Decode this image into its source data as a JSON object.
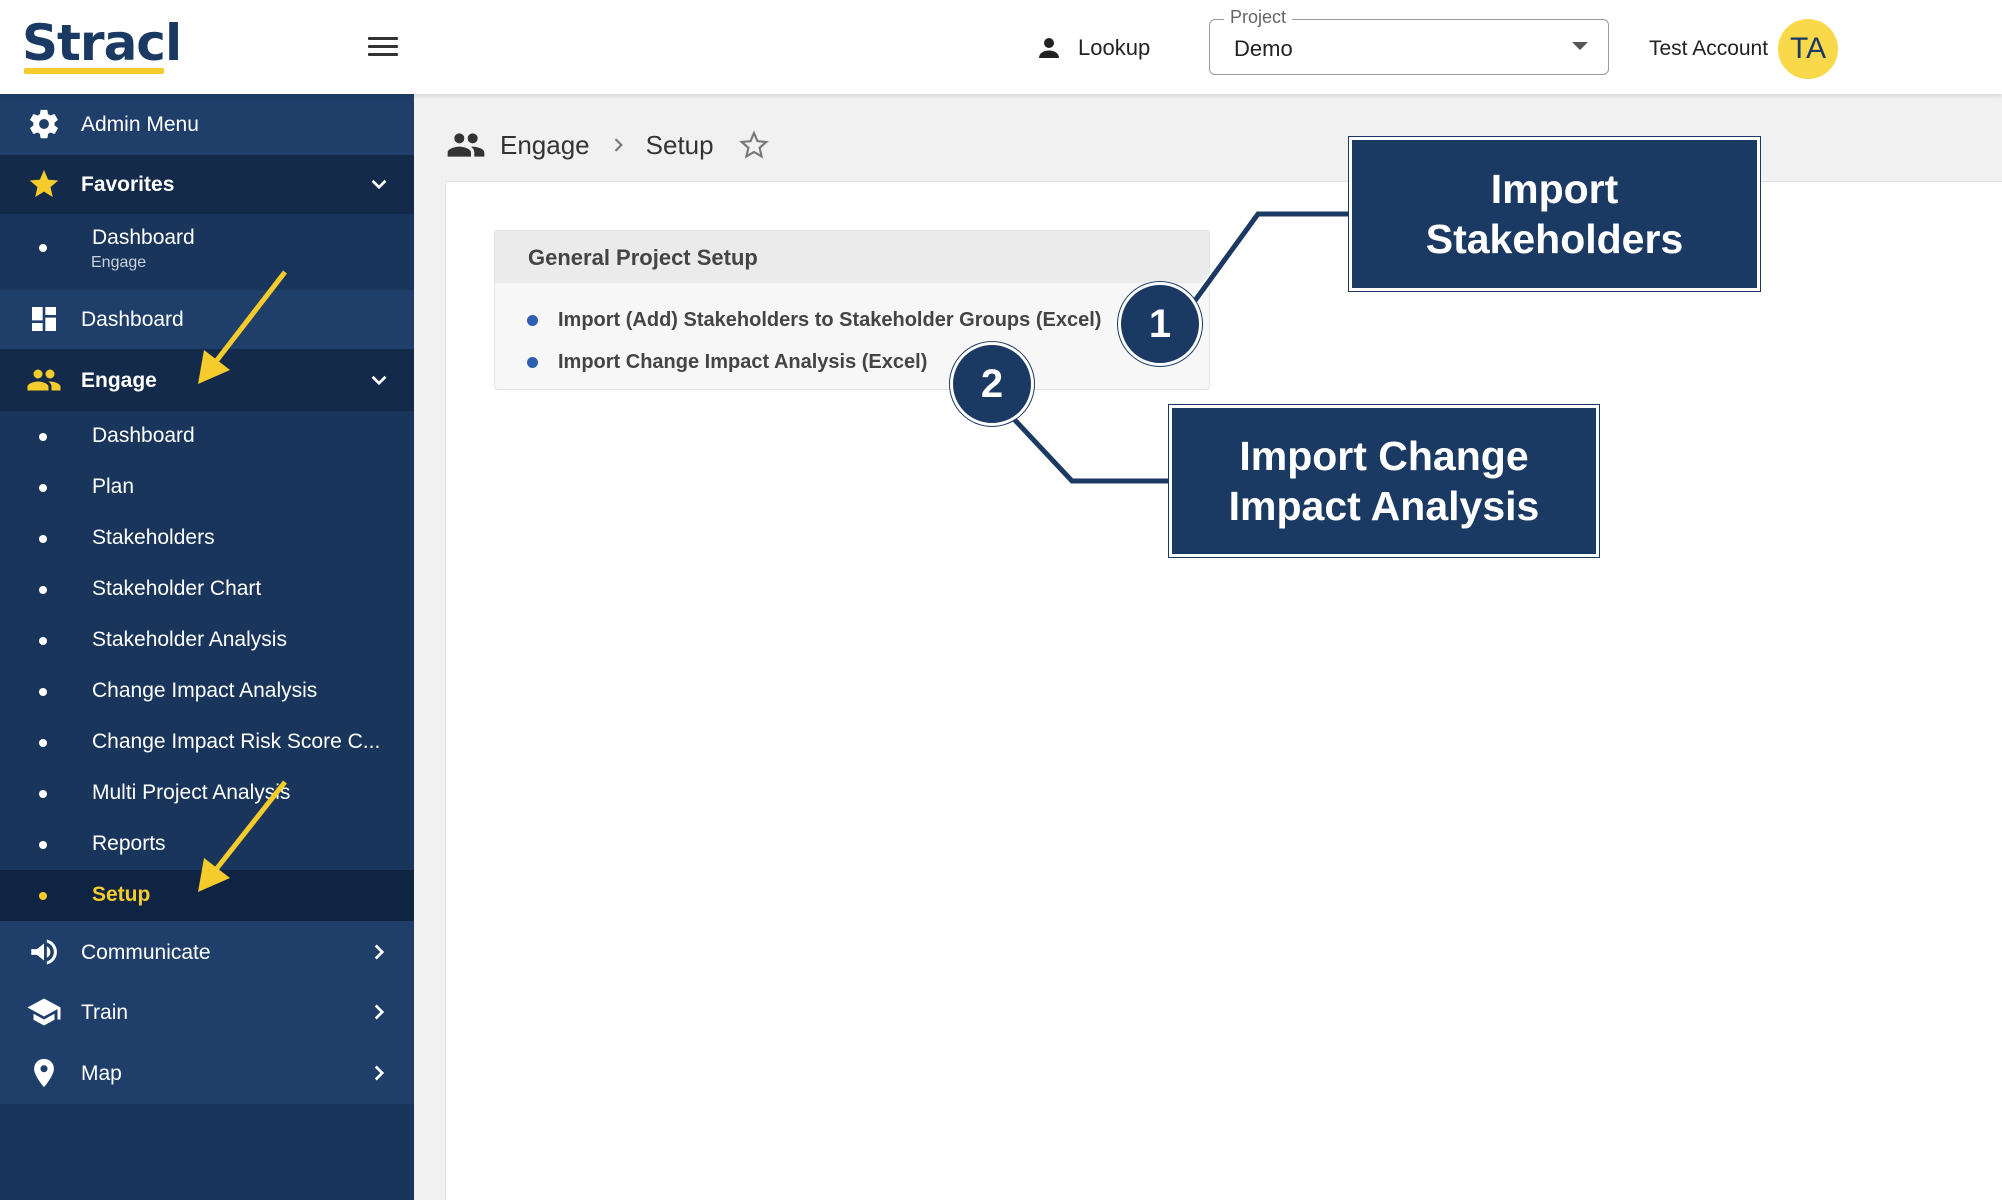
{
  "brand": {
    "logo_text": "Stracl",
    "accent": "#f5cc2b",
    "navy": "#1b3a63"
  },
  "header": {
    "lookup_label": "Lookup",
    "project_label": "Project",
    "project_value": "Demo",
    "account_name": "Test Account",
    "avatar_initials": "TA"
  },
  "sidebar": {
    "admin_menu": "Admin Menu",
    "favorites": {
      "label": "Favorites",
      "items": [
        {
          "label": "Dashboard",
          "sublabel": "Engage"
        }
      ]
    },
    "dashboard": "Dashboard",
    "engage": {
      "label": "Engage",
      "items": [
        {
          "label": "Dashboard"
        },
        {
          "label": "Plan"
        },
        {
          "label": "Stakeholders"
        },
        {
          "label": "Stakeholder Chart"
        },
        {
          "label": "Stakeholder Analysis"
        },
        {
          "label": "Change Impact Analysis"
        },
        {
          "label": "Change Impact Risk Score C..."
        },
        {
          "label": "Multi Project Analysis"
        },
        {
          "label": "Reports"
        },
        {
          "label": "Setup",
          "active": true
        }
      ]
    },
    "communicate": "Communicate",
    "train": "Train",
    "map": "Map"
  },
  "breadcrumb": {
    "section": "Engage",
    "page": "Setup"
  },
  "card": {
    "title": "General Project Setup",
    "links": [
      "Import (Add) Stakeholders to Stakeholder Groups (Excel)",
      "Import Change Impact Analysis (Excel)"
    ]
  },
  "callouts": [
    {
      "number": "1",
      "text": "Import Stakeholders"
    },
    {
      "number": "2",
      "text": "Import Change Impact Analysis"
    }
  ]
}
